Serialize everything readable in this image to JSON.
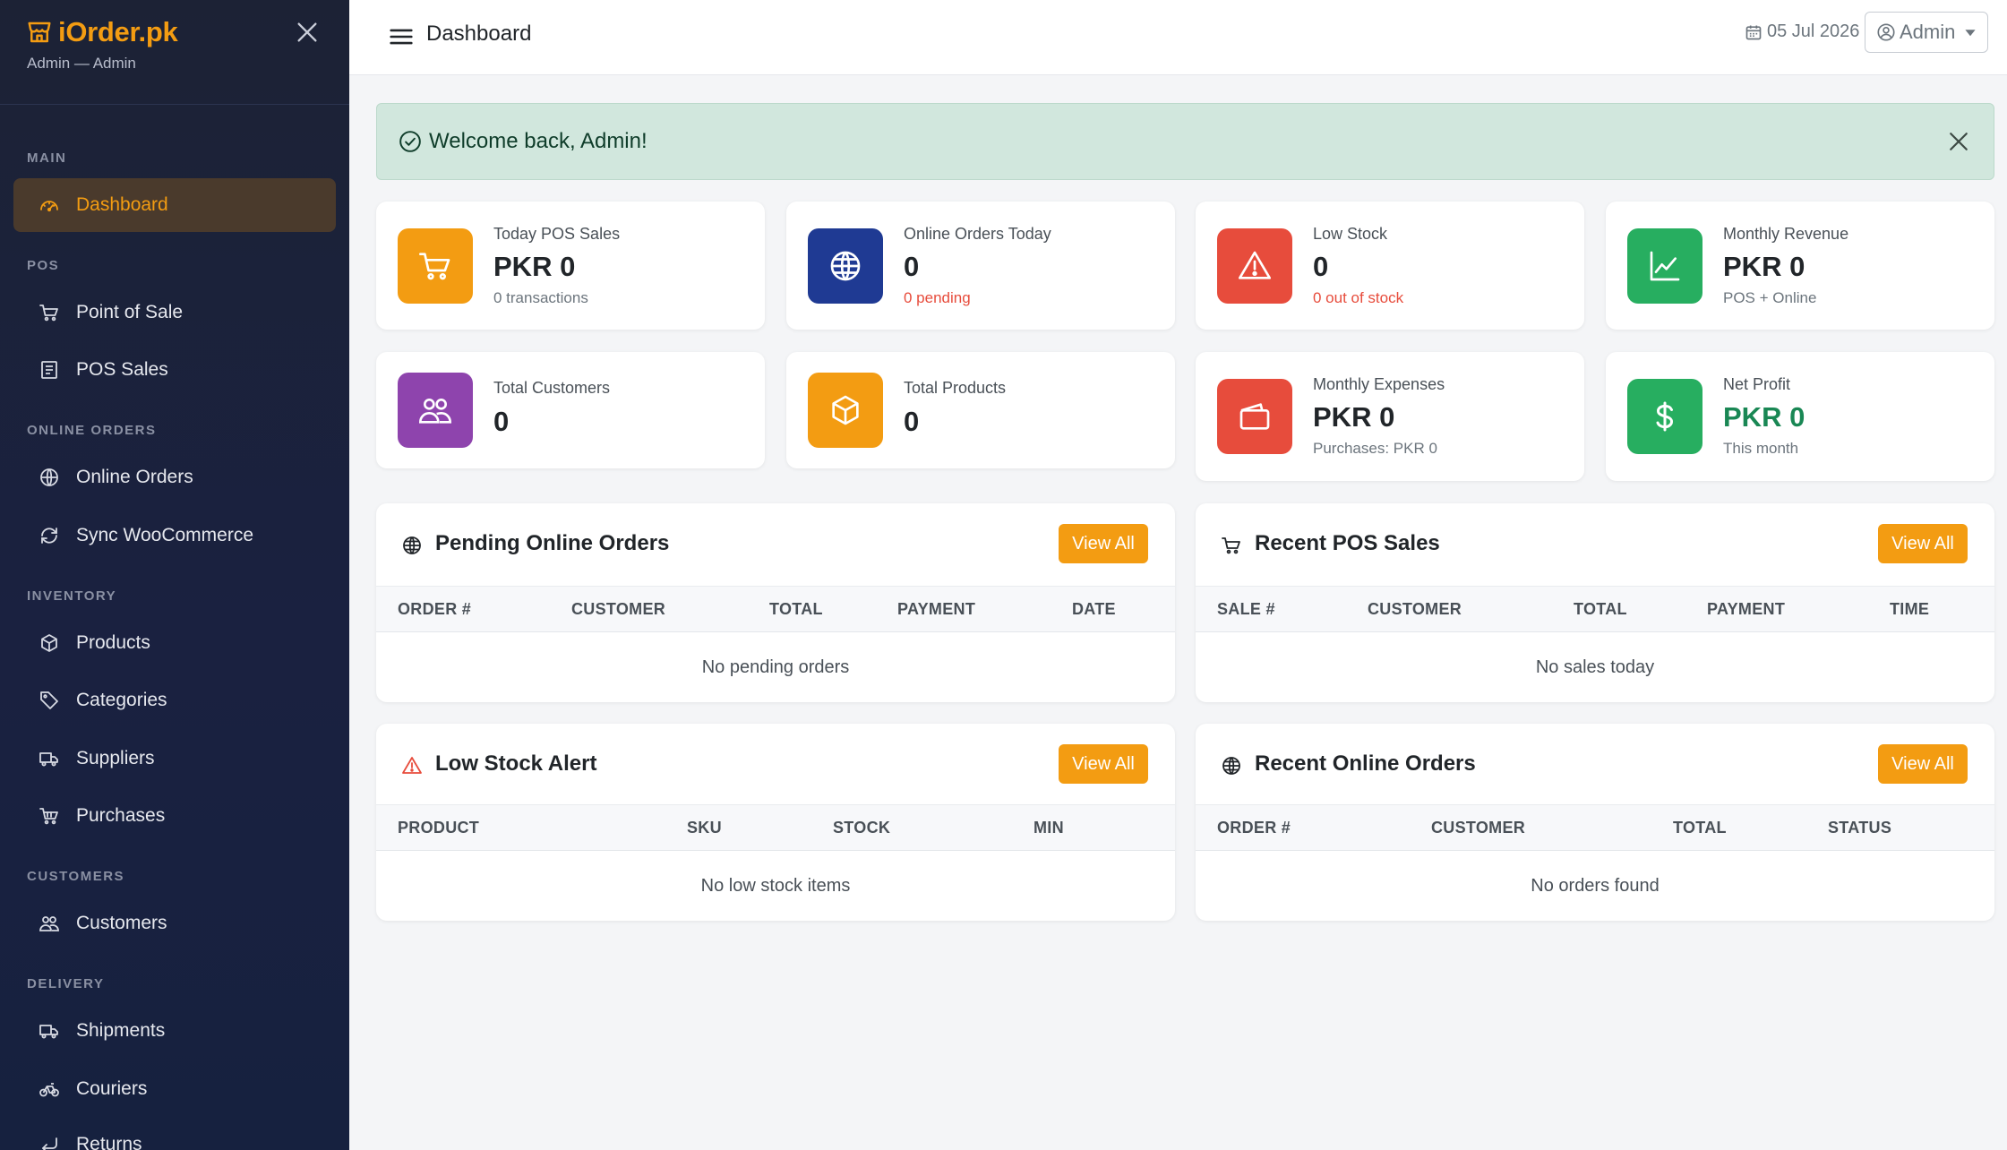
{
  "app": {
    "brand": "iOrder.pk",
    "user_line": "Admin — Admin"
  },
  "sidebar": {
    "sections": [
      "MAIN",
      "POS",
      "ONLINE ORDERS",
      "INVENTORY",
      "CUSTOMERS",
      "DELIVERY"
    ],
    "items": [
      {
        "label": "Dashboard",
        "icon": "dashboard-icon",
        "active": true
      },
      {
        "label": "Point of Sale",
        "icon": "cart-icon"
      },
      {
        "label": "POS Sales",
        "icon": "receipt-icon"
      },
      {
        "label": "Online Orders",
        "icon": "globe-icon"
      },
      {
        "label": "Sync WooCommerce",
        "icon": "sync-icon"
      },
      {
        "label": "Products",
        "icon": "box-icon"
      },
      {
        "label": "Categories",
        "icon": "tags-icon"
      },
      {
        "label": "Suppliers",
        "icon": "truck-icon"
      },
      {
        "label": "Purchases",
        "icon": "basket-icon"
      },
      {
        "label": "Customers",
        "icon": "people-icon"
      },
      {
        "label": "Shipments",
        "icon": "truck-icon"
      },
      {
        "label": "Couriers",
        "icon": "bicycle-icon"
      },
      {
        "label": "Returns",
        "icon": "return-icon"
      }
    ]
  },
  "topbar": {
    "title": "Dashboard",
    "date": "05 Jul 2026",
    "user": "Admin"
  },
  "alert": {
    "text": "Welcome back, Admin!"
  },
  "stats": [
    {
      "label": "Today POS Sales",
      "value": "PKR 0",
      "sub": "0 transactions",
      "icon": "cart-icon",
      "color": "#f39c12"
    },
    {
      "label": "Online Orders Today",
      "value": "0",
      "sub": "0 pending",
      "icon": "globe-icon",
      "color": "#1f3a93"
    },
    {
      "label": "Low Stock",
      "value": "0",
      "sub": "0 out of stock",
      "icon": "warning-icon",
      "color": "#e74c3c"
    },
    {
      "label": "Monthly Revenue",
      "value": "PKR 0",
      "sub": "POS + Online",
      "icon": "chart-line-icon",
      "color": "#27ae60"
    },
    {
      "label": "Total Customers",
      "value": "0",
      "icon": "people-icon",
      "color": "#8e44ad"
    },
    {
      "label": "Total Products",
      "value": "0",
      "icon": "box-icon",
      "color": "#f39c12"
    },
    {
      "label": "Monthly Expenses",
      "value": "PKR 0",
      "sub": "Purchases: PKR 0",
      "icon": "wallet-icon",
      "color": "#e74c3c"
    },
    {
      "label": "Net Profit",
      "value": "PKR 0",
      "sub": "This month",
      "icon": "dollar-icon",
      "color": "#27ae60"
    }
  ],
  "panels": {
    "view_all": "View All",
    "pending": {
      "title": "Pending Online Orders",
      "columns": [
        "ORDER #",
        "CUSTOMER",
        "TOTAL",
        "PAYMENT",
        "DATE"
      ],
      "empty": "No pending orders"
    },
    "pos": {
      "title": "Recent POS Sales",
      "columns": [
        "SALE #",
        "CUSTOMER",
        "TOTAL",
        "PAYMENT",
        "TIME"
      ],
      "empty": "No sales today"
    },
    "lowstock": {
      "title": "Low Stock Alert",
      "columns": [
        "PRODUCT",
        "SKU",
        "STOCK",
        "MIN"
      ],
      "empty": "No low stock items"
    },
    "online": {
      "title": "Recent Online Orders",
      "columns": [
        "ORDER #",
        "CUSTOMER",
        "TOTAL",
        "STATUS"
      ],
      "empty": "No orders found"
    }
  },
  "colors": {
    "accent": "#f39c12",
    "sidebar_bg": "#1c2235",
    "alert_bg": "#d1e7dd",
    "danger": "#e74c3c",
    "success": "#198754"
  }
}
